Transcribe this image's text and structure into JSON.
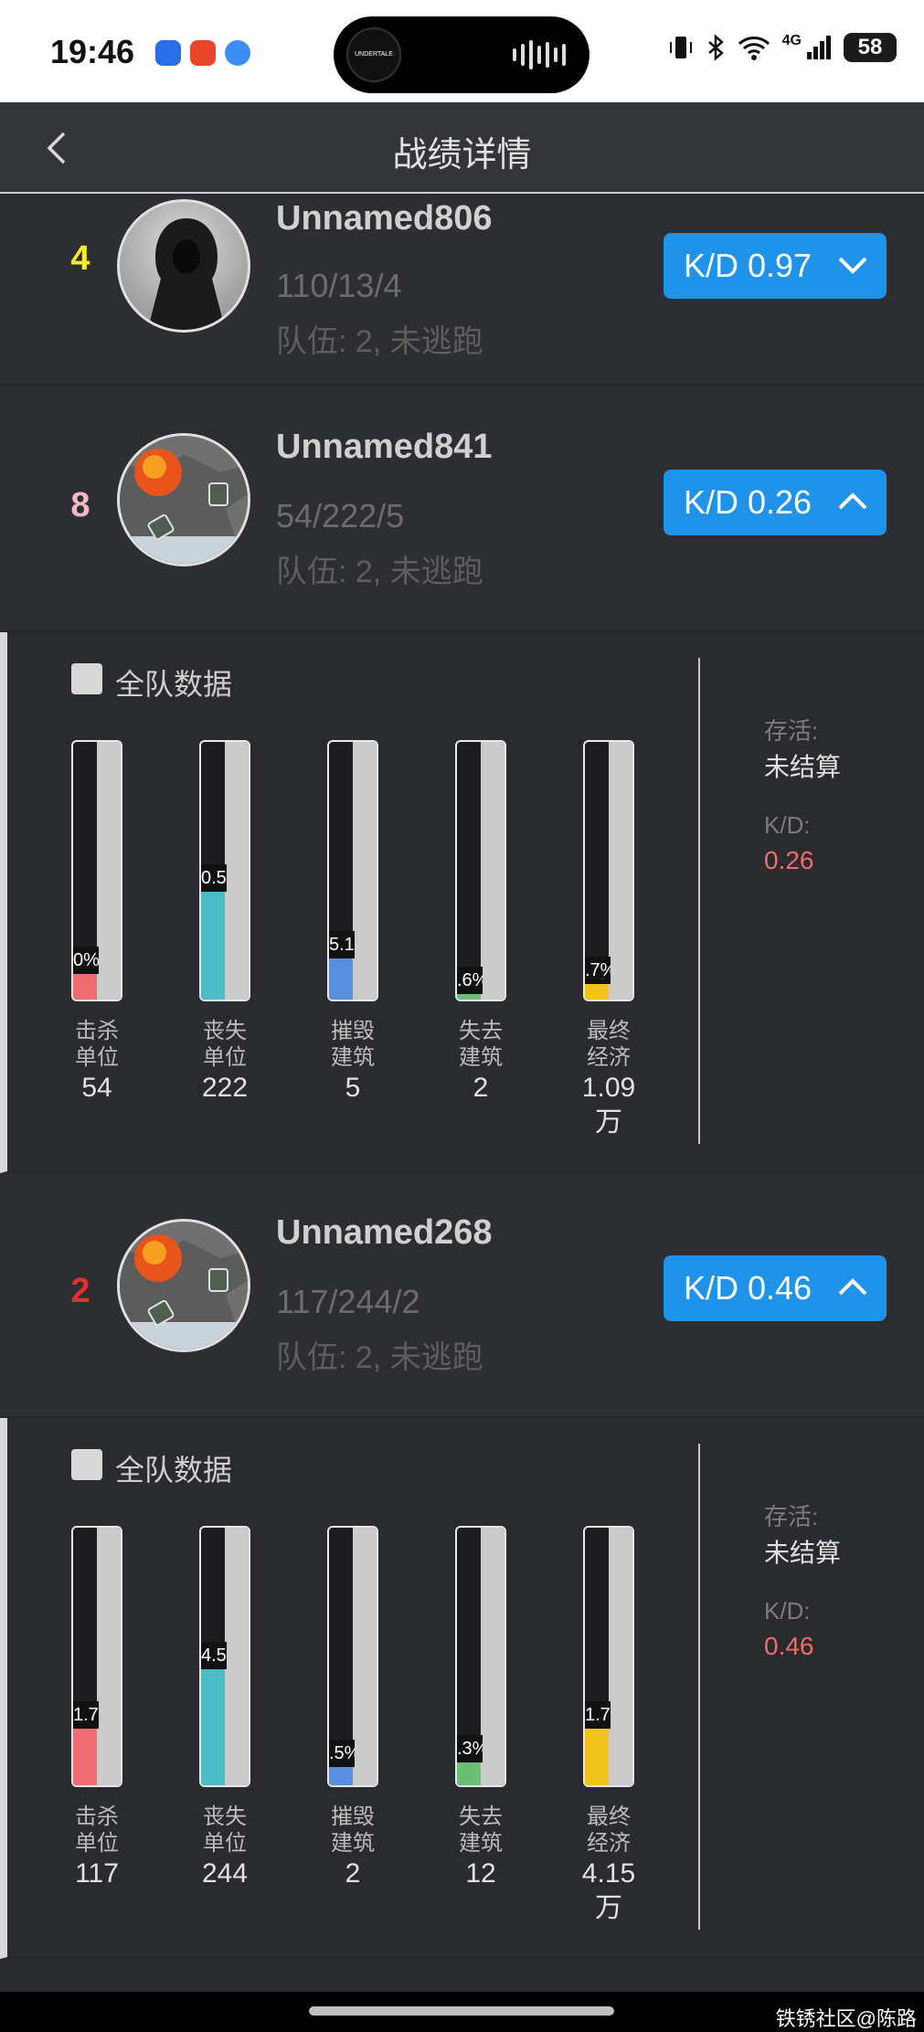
{
  "status": {
    "time": "19:46",
    "battery": "58",
    "network": "4G",
    "island_text": "UNDERTALE"
  },
  "header": {
    "title": "战绩详情"
  },
  "players": [
    {
      "rank": "4",
      "rank_color": "#f5ec2a",
      "name": "Unnamed806",
      "stats": "110/13/4",
      "team": "队伍: 2, 未逃跑",
      "kd": "K/D 0.97",
      "expanded": false
    },
    {
      "rank": "8",
      "rank_color": "#f6b7c4",
      "name": "Unnamed841",
      "stats": "54/222/5",
      "team": "队伍: 2, 未逃跑",
      "kd": "K/D 0.26",
      "expanded": true
    },
    {
      "rank": "2",
      "rank_color": "#e8302a",
      "name": "Unnamed268",
      "stats": "117/244/2",
      "team": "队伍: 2, 未逃跑",
      "kd": "K/D 0.46",
      "expanded": true
    }
  ],
  "details": [
    {
      "team_label": "全队数据",
      "survive_label": "存活:",
      "survive_value": "未结算",
      "kd_label": "K/D:",
      "kd_value": "0.26",
      "bars": [
        {
          "label1": "击杀",
          "label2": "单位",
          "value": "54",
          "value2": "",
          "pct_text": "0%",
          "fill": 0.1,
          "color": "#f06c72"
        },
        {
          "label1": "丧失",
          "label2": "单位",
          "value": "222",
          "value2": "",
          "pct_text": "0.5",
          "fill": 0.42,
          "color": "#4cbcc6"
        },
        {
          "label1": "摧毁",
          "label2": "建筑",
          "value": "5",
          "value2": "",
          "pct_text": "5.1",
          "fill": 0.16,
          "color": "#5a8fe0"
        },
        {
          "label1": "失去",
          "label2": "建筑",
          "value": "2",
          "value2": "",
          "pct_text": ".6%",
          "fill": 0.02,
          "color": "#6bbf74"
        },
        {
          "label1": "最终",
          "label2": "经济",
          "value": "1.09",
          "value2": "万",
          "pct_text": ".7%",
          "fill": 0.06,
          "color": "#f2c31a"
        }
      ]
    },
    {
      "team_label": "全队数据",
      "survive_label": "存活:",
      "survive_value": "未结算",
      "kd_label": "K/D:",
      "kd_value": "0.46",
      "bars": [
        {
          "label1": "击杀",
          "label2": "单位",
          "value": "117",
          "value2": "",
          "pct_text": "1.7",
          "fill": 0.22,
          "color": "#f06c72"
        },
        {
          "label1": "丧失",
          "label2": "单位",
          "value": "244",
          "value2": "",
          "pct_text": "4.5",
          "fill": 0.45,
          "color": "#4cbcc6"
        },
        {
          "label1": "摧毁",
          "label2": "建筑",
          "value": "2",
          "value2": "",
          "pct_text": ".5%",
          "fill": 0.07,
          "color": "#5a8fe0"
        },
        {
          "label1": "失去",
          "label2": "建筑",
          "value": "12",
          "value2": "",
          "pct_text": ".3%",
          "fill": 0.09,
          "color": "#6bbf74"
        },
        {
          "label1": "最终",
          "label2": "经济",
          "value": "4.15",
          "value2": "万",
          "pct_text": "1.7",
          "fill": 0.22,
          "color": "#f2c31a"
        }
      ]
    }
  ],
  "colors": {
    "kd_value": "#f06b6b",
    "button": "#1f93ea"
  },
  "watermark": "铁锈社区@陈路"
}
